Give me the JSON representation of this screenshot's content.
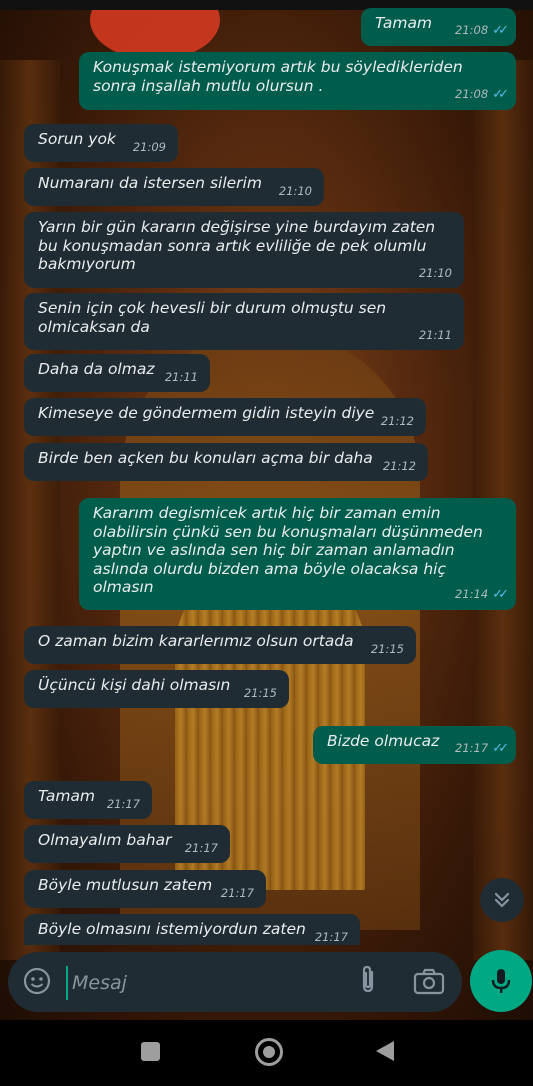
{
  "messages": [
    {
      "dir": "out",
      "text": "Tamam",
      "time": "21:08",
      "read": true
    },
    {
      "dir": "out",
      "text": "Konuşmak istemiyorum artık bu söyledikleriden sonra inşallah mutlu olursun .",
      "time": "21:08",
      "read": true
    },
    {
      "dir": "in",
      "text": "Sorun yok",
      "time": "21:09"
    },
    {
      "dir": "in",
      "text": "Numaranı da istersen silerim",
      "time": "21:10"
    },
    {
      "dir": "in",
      "text": "Yarın bir gün kararın değişirse yine burdayım zaten bu konuşmadan sonra artık evliliğe de pek olumlu bakmıyorum",
      "time": "21:10"
    },
    {
      "dir": "in",
      "text": "Senin için çok hevesli bir durum olmuştu sen olmicaksan da",
      "time": "21:11"
    },
    {
      "dir": "in",
      "text": "Daha da olmaz",
      "time": "21:11"
    },
    {
      "dir": "in",
      "text": "Kimeseye de göndermem gidin isteyin diye",
      "time": "21:12"
    },
    {
      "dir": "in",
      "text": "Birde ben açken bu konuları açma bir daha",
      "time": "21:12"
    },
    {
      "dir": "out",
      "text": "Kararım degismicek artık hiç bir zaman  emin olabilirsin çünkü sen bu konuşmaları düşünmeden yaptın ve  aslında sen hiç bir   zaman anlamadın aslında olurdu bizden ama böyle olacaksa hiç olmasın",
      "time": "21:14",
      "read": true
    },
    {
      "dir": "in",
      "text": "O zaman bizim kararlerımız olsun ortada",
      "time": "21:15"
    },
    {
      "dir": "in",
      "text": "Üçüncü kişi dahi olmasın",
      "time": "21:15"
    },
    {
      "dir": "out",
      "text": "Bizde olmucaz",
      "time": "21:17",
      "read": true
    },
    {
      "dir": "in",
      "text": "Tamam",
      "time": "21:17"
    },
    {
      "dir": "in",
      "text": "Olmayalım bahar",
      "time": "21:17"
    },
    {
      "dir": "in",
      "text": "Böyle mutlusun zatem",
      "time": "21:17"
    },
    {
      "dir": "in",
      "text": "Böyle olmasını istemiyordun zaten",
      "time": "21:17"
    }
  ],
  "composer": {
    "placeholder": "Mesaj"
  },
  "icons": {
    "emoji": "sticker-icon",
    "attach": "paperclip-icon",
    "camera": "camera-icon",
    "mic": "mic-icon",
    "scroll": "scroll-down-icon"
  },
  "colors": {
    "incoming": "#202c33",
    "outgoing": "#005c4b",
    "accent": "#00a884",
    "read_ticks": "#53bdeb"
  }
}
